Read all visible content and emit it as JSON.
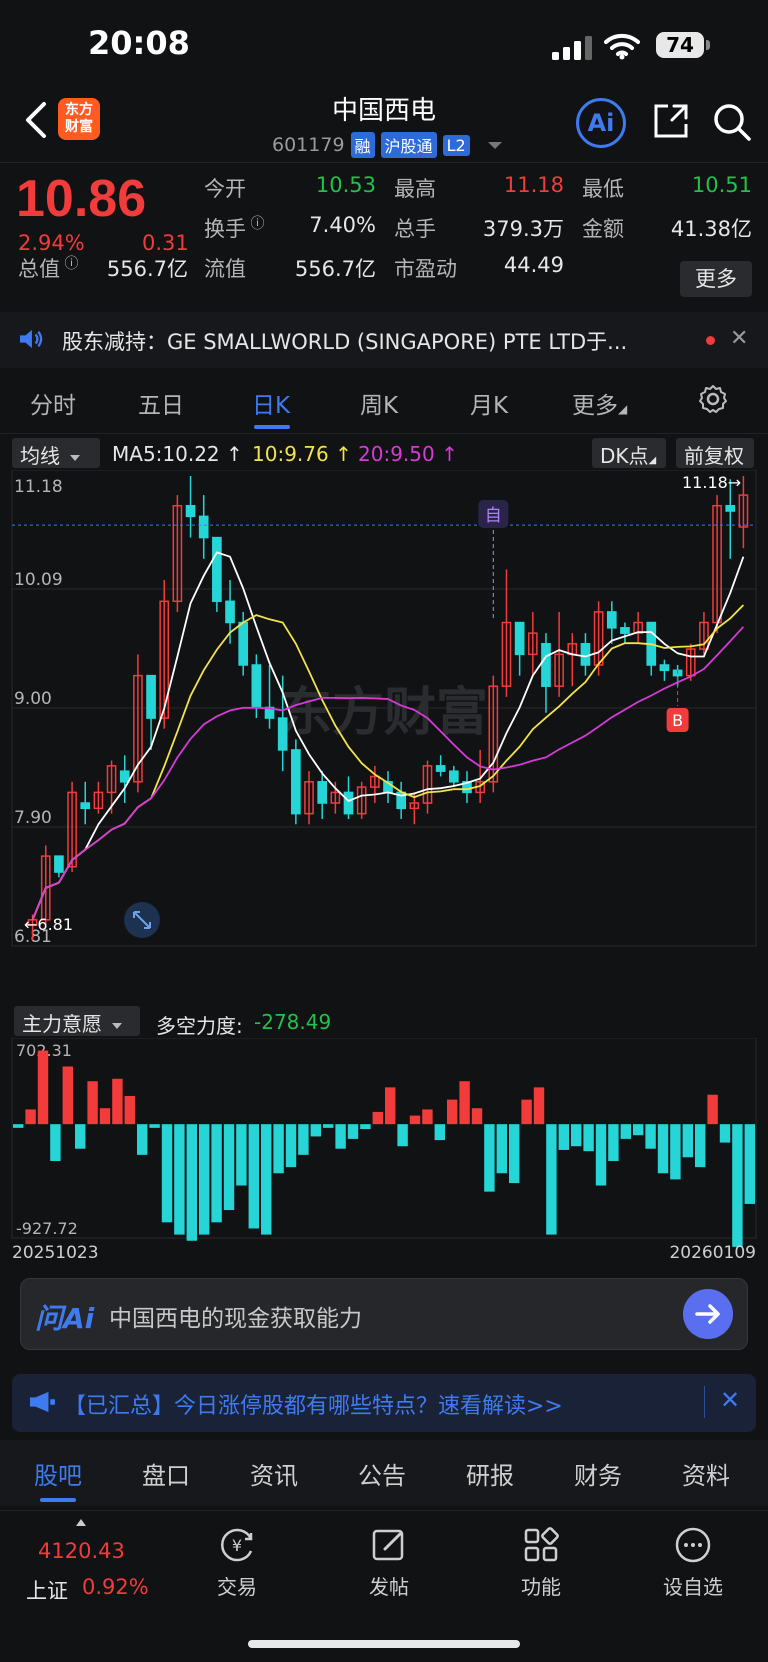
{
  "status": {
    "time": "20:08",
    "battery": "74"
  },
  "header": {
    "logo": "东方财富",
    "title": "中国西电",
    "code": "601179",
    "tags": [
      "融",
      "沪股通",
      "L2"
    ],
    "ai_label": "Ai"
  },
  "quote": {
    "price": "10.86",
    "pct": "2.94%",
    "change": "0.31",
    "rows": [
      [
        {
          "label": "今开",
          "value": "10.53",
          "color": "green"
        },
        {
          "label": "最高",
          "value": "11.18",
          "color": "red"
        },
        {
          "label": "最低",
          "value": "10.51",
          "color": "green"
        }
      ],
      [
        {
          "label": "换手",
          "value": "7.40%",
          "color": ""
        },
        {
          "label": "总手",
          "value": "379.3万",
          "color": ""
        },
        {
          "label": "金额",
          "value": "41.38亿",
          "color": ""
        }
      ],
      [
        {
          "label": "总值",
          "value": "556.7亿",
          "color": ""
        },
        {
          "label": "流值",
          "value": "556.7亿",
          "color": ""
        },
        {
          "label": "市盈动",
          "value": "44.49",
          "color": ""
        }
      ]
    ],
    "more": "更多"
  },
  "notice": {
    "text": "股东减持：GE SMALLWORLD (SINGAPORE) PTE LTD于..."
  },
  "ktabs": [
    "分时",
    "五日",
    "日K",
    "周K",
    "月K",
    "更多"
  ],
  "indicators": {
    "main_dropdown": "均线",
    "ma5": "MA5:10.22",
    "ma10": "10:9.76",
    "ma20": "20:9.50",
    "dk": "DK点",
    "adjust": "前复权"
  },
  "sub": {
    "dropdown": "主力意愿",
    "label": "多空力度:",
    "value": "-278.49"
  },
  "ai_ask": {
    "logo": "问Ai",
    "question": "中国西电的现金获取能力"
  },
  "promo": {
    "text": "【已汇总】今日涨停股都有哪些特点？速看解读>>"
  },
  "bottom_tabs": [
    "股吧",
    "盘口",
    "资讯",
    "公告",
    "研报",
    "财务",
    "资料"
  ],
  "footer": {
    "index_value": "4120.43",
    "index_name": "上证",
    "index_pct": "0.92%",
    "buttons": [
      "交易",
      "发帖",
      "功能",
      "设自选"
    ]
  },
  "chart_data": {
    "type": "candlestick",
    "title": "",
    "y_ticks": [
      "11.18",
      "10.09",
      "9.00",
      "7.90",
      "6.81"
    ],
    "ylim": [
      6.81,
      11.18
    ],
    "x_labels": [
      "20251023",
      "20260109"
    ],
    "high_marker": "11.18",
    "low_marker": "6.81",
    "markers": [
      "自",
      "B"
    ],
    "watermark": "东方财富",
    "candles": [
      [
        6.95,
        7.05,
        6.81,
        7.0
      ],
      [
        7.0,
        7.7,
        6.95,
        7.6
      ],
      [
        7.6,
        7.55,
        7.4,
        7.45
      ],
      [
        7.5,
        8.3,
        7.45,
        8.2
      ],
      [
        8.1,
        8.3,
        7.9,
        8.05
      ],
      [
        8.05,
        8.3,
        8.0,
        8.2
      ],
      [
        8.2,
        8.5,
        8.0,
        8.45
      ],
      [
        8.4,
        8.55,
        8.1,
        8.3
      ],
      [
        8.3,
        9.5,
        8.2,
        9.3
      ],
      [
        9.3,
        9.3,
        8.6,
        8.9
      ],
      [
        8.9,
        10.2,
        8.8,
        10.0
      ],
      [
        10.0,
        11.0,
        9.9,
        10.9
      ],
      [
        10.9,
        11.18,
        10.6,
        10.8
      ],
      [
        10.8,
        11.0,
        10.4,
        10.6
      ],
      [
        10.6,
        10.6,
        9.9,
        10.0
      ],
      [
        10.0,
        10.2,
        9.6,
        9.8
      ],
      [
        9.8,
        9.9,
        9.3,
        9.4
      ],
      [
        9.4,
        9.5,
        8.9,
        9.0
      ],
      [
        9.0,
        9.4,
        8.8,
        8.9
      ],
      [
        8.9,
        9.3,
        8.4,
        8.6
      ],
      [
        8.6,
        8.7,
        7.9,
        8.0
      ],
      [
        8.0,
        8.4,
        7.9,
        8.3
      ],
      [
        8.3,
        8.4,
        7.95,
        8.1
      ],
      [
        8.1,
        8.3,
        8.0,
        8.2
      ],
      [
        8.2,
        8.35,
        7.95,
        8.0
      ],
      [
        8.0,
        8.3,
        7.95,
        8.25
      ],
      [
        8.25,
        8.45,
        8.1,
        8.35
      ],
      [
        8.3,
        8.4,
        8.1,
        8.2
      ],
      [
        8.2,
        8.3,
        7.95,
        8.05
      ],
      [
        8.05,
        8.2,
        7.9,
        8.1
      ],
      [
        8.1,
        8.5,
        8.0,
        8.45
      ],
      [
        8.45,
        8.55,
        8.35,
        8.4
      ],
      [
        8.4,
        8.45,
        8.25,
        8.3
      ],
      [
        8.3,
        8.4,
        8.1,
        8.2
      ],
      [
        8.2,
        8.6,
        8.1,
        8.3
      ],
      [
        8.3,
        9.3,
        8.2,
        9.2
      ],
      [
        9.2,
        10.3,
        9.1,
        9.8
      ],
      [
        9.8,
        9.8,
        9.3,
        9.5
      ],
      [
        9.5,
        9.9,
        9.3,
        9.7
      ],
      [
        9.6,
        9.7,
        8.95,
        9.2
      ],
      [
        9.2,
        9.9,
        9.1,
        9.5
      ],
      [
        9.5,
        9.7,
        9.2,
        9.6
      ],
      [
        9.6,
        9.7,
        9.3,
        9.4
      ],
      [
        9.4,
        10.0,
        9.3,
        9.9
      ],
      [
        9.9,
        10.0,
        9.6,
        9.75
      ],
      [
        9.75,
        9.8,
        9.6,
        9.7
      ],
      [
        9.7,
        9.9,
        9.6,
        9.8
      ],
      [
        9.8,
        9.8,
        9.3,
        9.4
      ],
      [
        9.4,
        9.45,
        9.25,
        9.35
      ],
      [
        9.35,
        9.4,
        9.2,
        9.3
      ],
      [
        9.3,
        9.6,
        9.25,
        9.55
      ],
      [
        9.55,
        9.9,
        9.5,
        9.8
      ],
      [
        9.8,
        11.0,
        9.7,
        10.9
      ],
      [
        10.9,
        11.15,
        10.4,
        10.85
      ],
      [
        10.7,
        11.18,
        10.5,
        11.0
      ]
    ],
    "series": [
      {
        "name": "MA5"
      },
      {
        "name": "10"
      },
      {
        "name": "20"
      }
    ],
    "sub_chart": {
      "type": "bar",
      "y_ticks": [
        "702.31",
        "-927.72"
      ],
      "ylim": [
        -927.72,
        702.31
      ],
      "values": [
        -30,
        120,
        600,
        -300,
        470,
        -200,
        350,
        130,
        370,
        230,
        -250,
        -30,
        -800,
        -900,
        -950,
        -900,
        -800,
        -700,
        -500,
        -850,
        -900,
        -400,
        -350,
        -250,
        -100,
        -30,
        -200,
        -120,
        -40,
        100,
        300,
        -180,
        70,
        120,
        -130,
        200,
        350,
        130,
        -550,
        -400,
        -480,
        200,
        300,
        -900,
        -210,
        -180,
        -220,
        -500,
        -300,
        -120,
        -90,
        -200,
        -400,
        -450,
        -270,
        -350,
        240,
        -150,
        -1000,
        -650
      ]
    }
  }
}
